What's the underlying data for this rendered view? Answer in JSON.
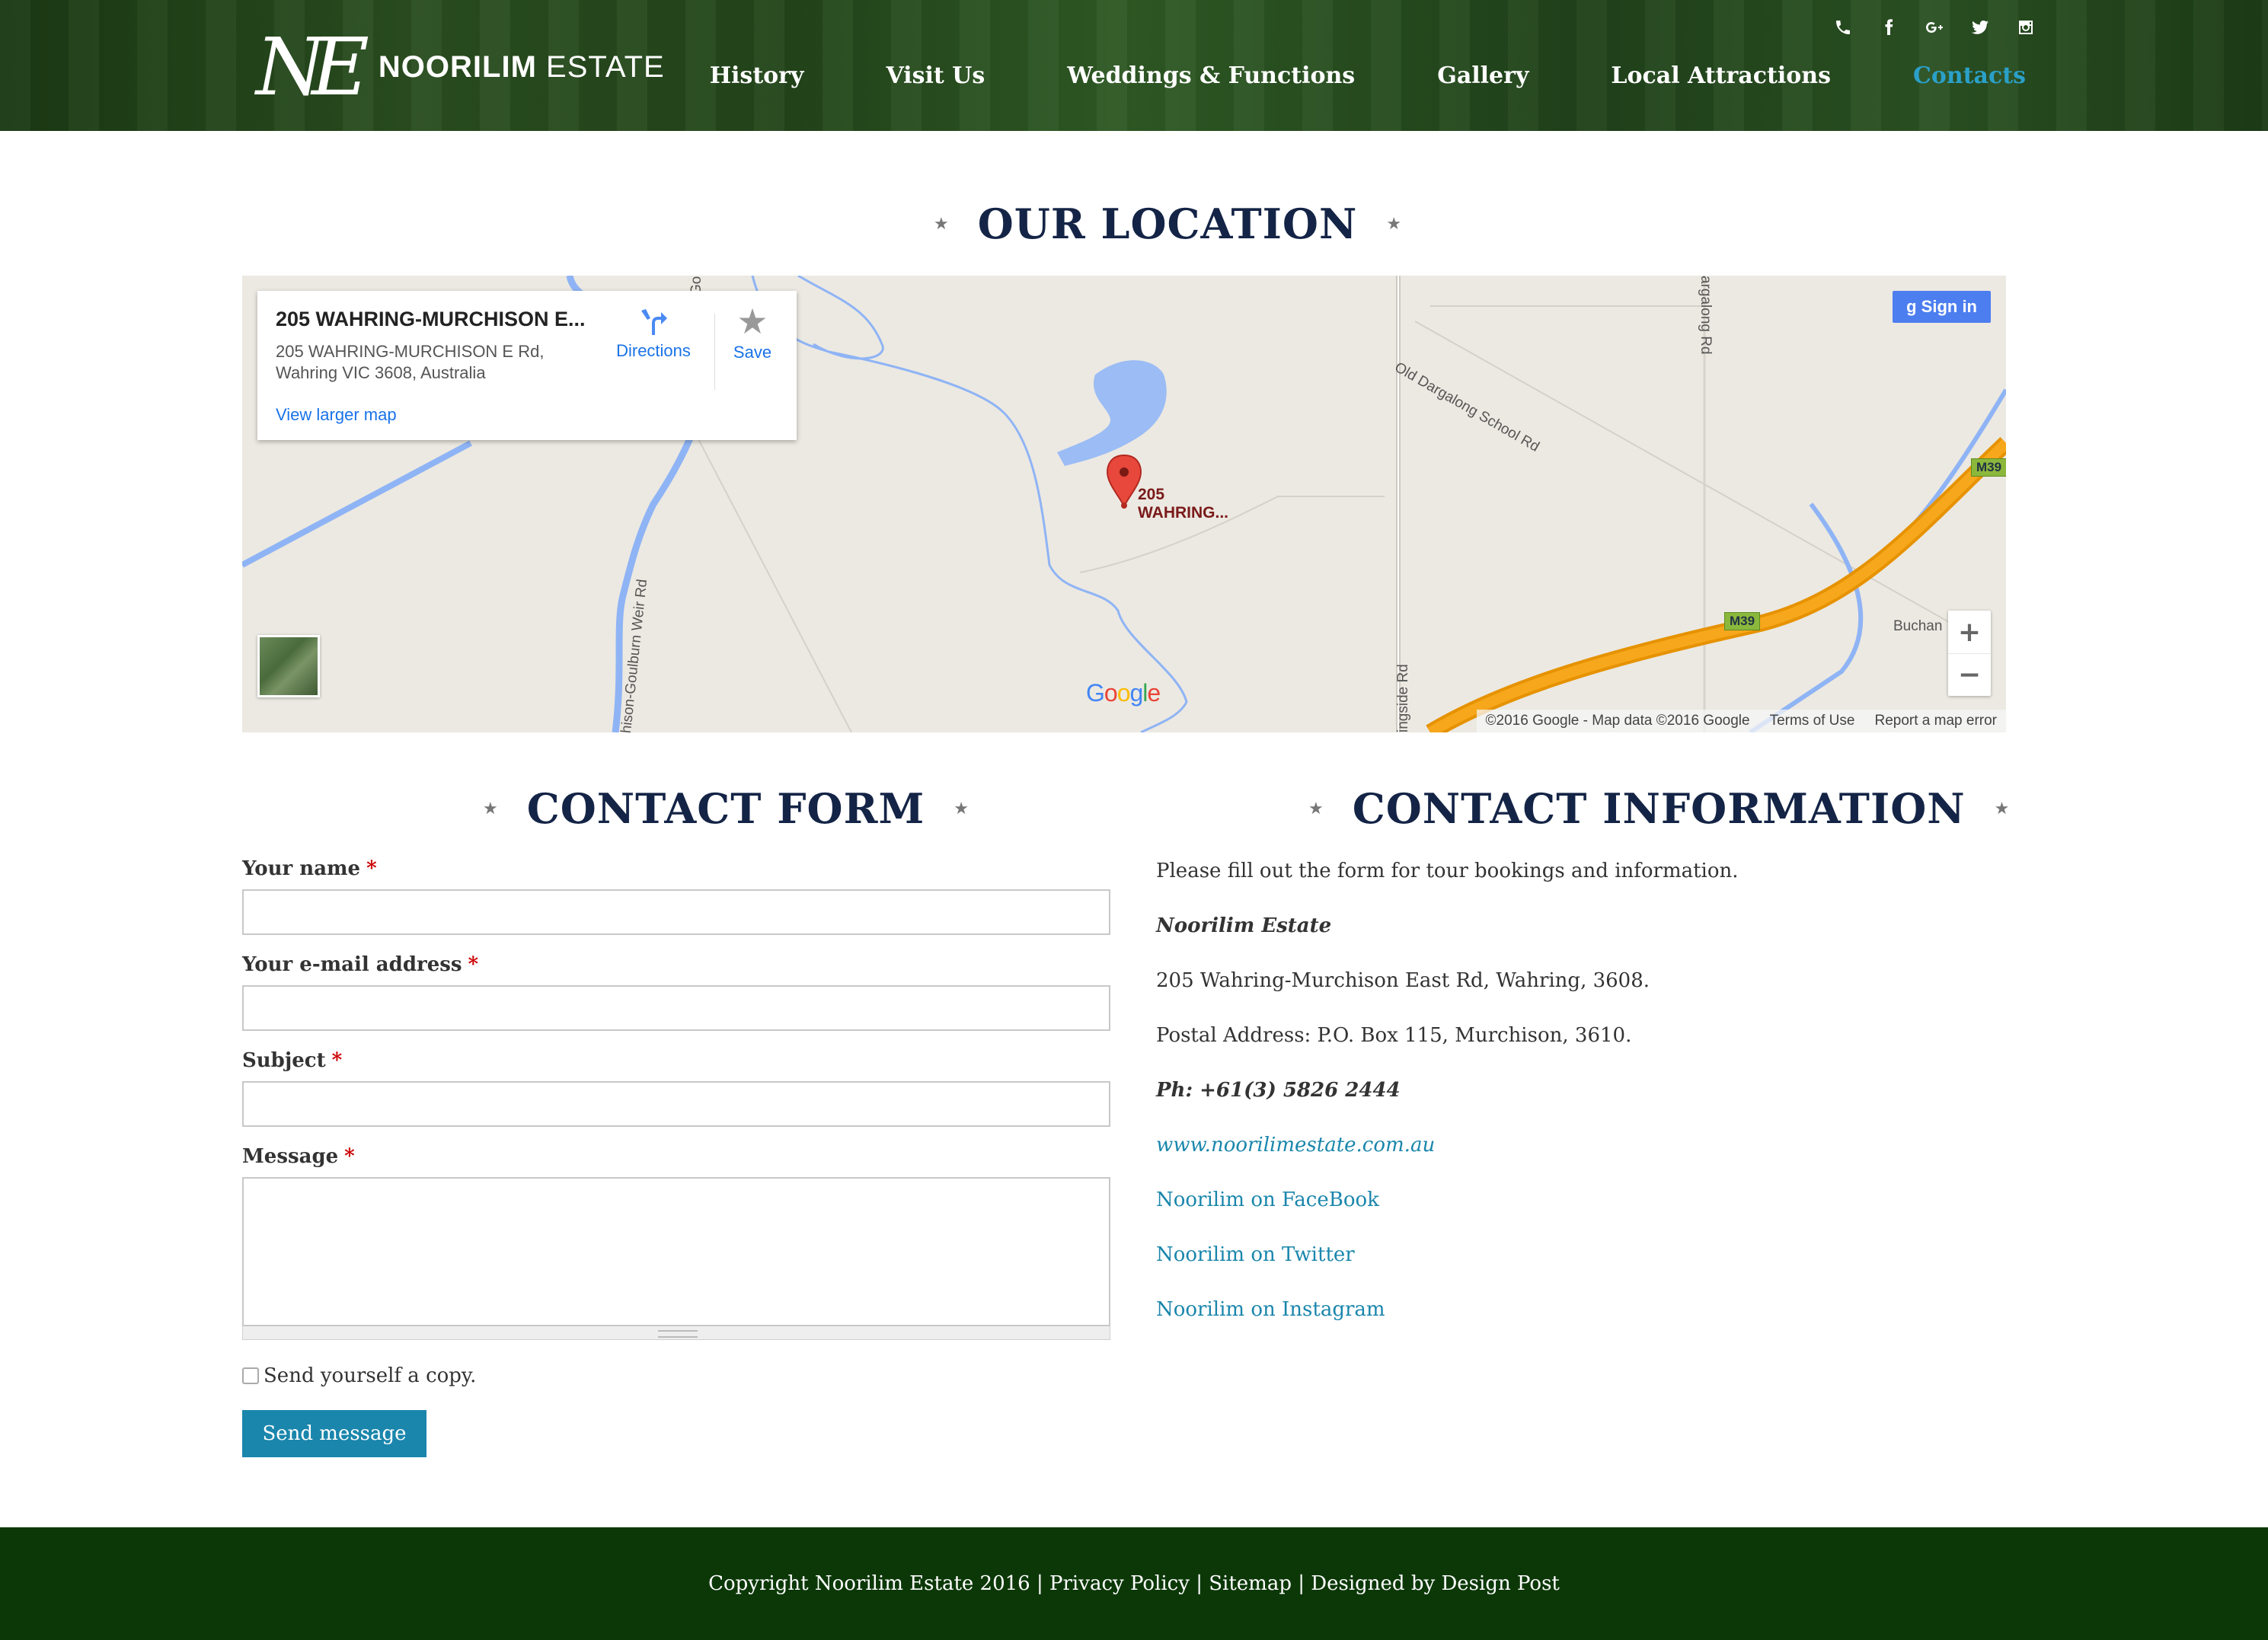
{
  "brand": {
    "monogram": "NE",
    "name_bold": "NOORILIM",
    "name_regular": "ESTATE"
  },
  "social": [
    "phone-icon",
    "facebook-icon",
    "google-plus-icon",
    "twitter-icon",
    "instagram-icon"
  ],
  "nav": {
    "items": [
      {
        "label": "History",
        "active": false
      },
      {
        "label": "Visit Us",
        "active": false
      },
      {
        "label": "Weddings & Functions",
        "active": false
      },
      {
        "label": "Gallery",
        "active": false
      },
      {
        "label": "Local Attractions",
        "active": false
      },
      {
        "label": "Contacts",
        "active": true
      }
    ],
    "active_color": "#2aa0c8"
  },
  "location": {
    "title": "OUR LOCATION",
    "map": {
      "card_title": "205 WAHRING-MURCHISON E...",
      "card_address_line1": "205 WAHRING-MURCHISON E Rd,",
      "card_address_line2": "Wahring VIC 3608, Australia",
      "view_larger": "View larger map",
      "directions": "Directions",
      "save": "Save",
      "sign_in": "Sign in",
      "pin_label_1": "205",
      "pin_label_2": "WAHRING...",
      "google": "Google",
      "attribution": "©2016 Google - Map data ©2016 Google",
      "terms": "Terms of Use",
      "report": "Report a map error",
      "zoom_in": "+",
      "zoom_out": "−",
      "labels": {
        "road1": "Old Dargalong School Rd",
        "road2": "argalong Rd",
        "road3": "hison-Goulburn Weir Rd",
        "road4": "ingside Rd",
        "road5": "Buchan",
        "road6": "Go",
        "m39": "M39"
      }
    }
  },
  "contact_form": {
    "title": "CONTACT FORM",
    "fields": {
      "name": "Your name",
      "email": "Your e-mail address",
      "subject": "Subject",
      "message": "Message"
    },
    "required_mark": "*",
    "copy_label": "Send yourself a copy.",
    "submit": "Send message"
  },
  "contact_info": {
    "title": "CONTACT INFORMATION",
    "intro": "Please fill out the form for tour bookings and information.",
    "company": "Noorilim Estate",
    "address": "205 Wahring-Murchison East Rd, Wahring, 3608.",
    "postal": "Postal Address: P.O. Box 115, Murchison, 3610.",
    "phone": "Ph: +61(3) 5826 2444",
    "website": "www.noorilimestate.com.au",
    "facebook": "Noorilim on FaceBook",
    "twitter": "Noorilim on Twitter",
    "instagram": "Noorilim on Instagram"
  },
  "footer": {
    "text": "Copyright Noorilim Estate 2016 | Privacy Policy | Sitemap | Designed by Design Post"
  }
}
